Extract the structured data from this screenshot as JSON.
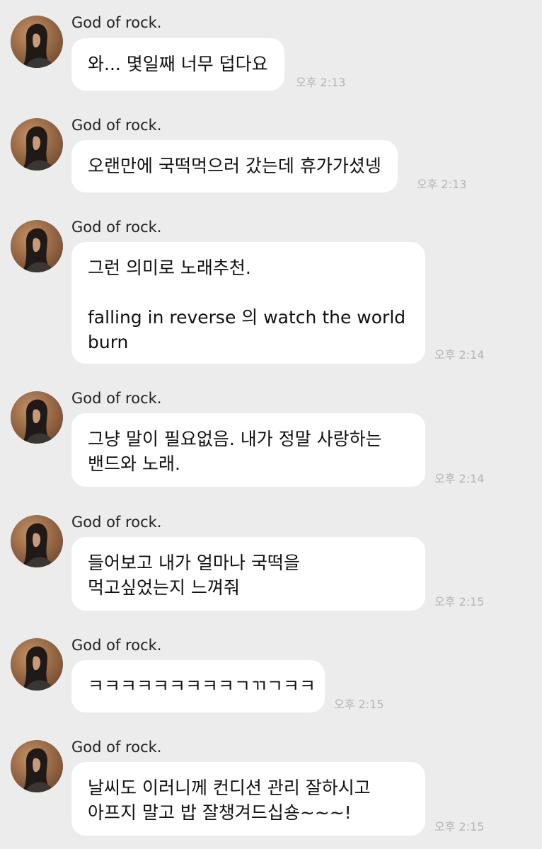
{
  "messages": [
    {
      "sender": "God of rock.",
      "lines": [
        "와... 몇일째 너무 덥다요"
      ],
      "time": "오후 2:13"
    },
    {
      "sender": "God of rock.",
      "lines": [
        "오랜만에 국떡먹으러 갔는데 휴가가셨넹"
      ],
      "time": "오후 2:13"
    },
    {
      "sender": "God of rock.",
      "lines": [
        "그런 의미로 노래추천.",
        "",
        "falling in reverse 의 watch the world",
        "burn"
      ],
      "time": "오후 2:14"
    },
    {
      "sender": "God of rock.",
      "lines": [
        "그냥 말이 필요없음. 내가 정말 사랑하는",
        "밴드와 노래."
      ],
      "time": "오후 2:14"
    },
    {
      "sender": "God of rock.",
      "lines": [
        "들어보고 내가 얼마나 국떡을",
        "먹고싶었는지 느껴줘"
      ],
      "time": "오후 2:15"
    },
    {
      "sender": "God of rock.",
      "lines": [
        "ㅋㅋㅋㅋㅋㅋㅋㅋㅋㄱㄲㄱㅋㅋ"
      ],
      "time": "오후 2:15"
    },
    {
      "sender": "God of rock.",
      "lines": [
        "날씨도 이러니께 컨디션 관리 잘하시고",
        "아프지 말고 밥 잘챙겨드십숑~~~!"
      ],
      "time": "오후 2:15"
    }
  ]
}
